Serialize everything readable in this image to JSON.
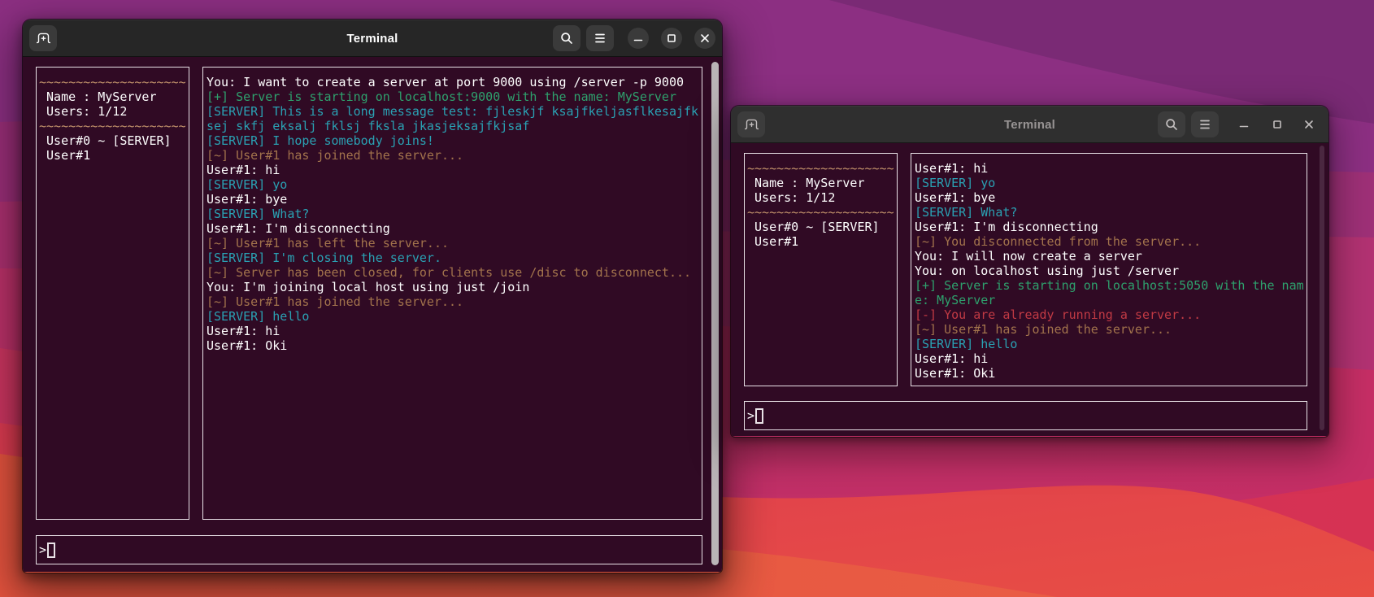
{
  "palette": {
    "term-bg": "#300a24",
    "panel-border": "#e9e2e7",
    "c-fg": "#ffffff",
    "c-green": "#2ea16d",
    "c-cyan": "#2aa1b3",
    "c-brown": "#a2734c",
    "c-tan": "#c4946c",
    "c-red": "#c13a44",
    "hdr-focused": "#262626",
    "hdr-unfocused": "#2f2f2f",
    "btn-focused": "#3a3a3a",
    "btn-unfocused": "#3c3c3c",
    "scroll-focused": "#bab4b7",
    "scroll-unfocused": "#4a2740",
    "w0": "#7a2a75",
    "w1": "#8c2f82",
    "w2a": "#9a2e78",
    "w2b": "#9e3077",
    "w3a": "#ac3070",
    "w3b": "#b23272",
    "w4a": "#bc3169",
    "w4b": "#c52e65",
    "w5a": "#cc3560",
    "w5b": "#d63253",
    "w6a": "#dc3a51",
    "w6b": "#e84e44",
    "w7a": "#e5533e",
    "w7b": "#e95c44"
  },
  "windows": {
    "left": {
      "titlebar": {
        "title": "Terminal"
      },
      "sidebar": {
        "rows": [
          {
            "t": "~~~~~~~~~~~~~~~~~~~~",
            "c": "tan"
          },
          {
            "t": " Name : MyServer",
            "c": "fg"
          },
          {
            "t": " Users: 1/12",
            "c": "fg"
          },
          {
            "t": "~~~~~~~~~~~~~~~~~~~~",
            "c": "tan"
          },
          {
            "t": " User#0 ~ [SERVER]",
            "c": "fg"
          },
          {
            "t": " User#1",
            "c": "fg"
          }
        ]
      },
      "chat": {
        "rows": [
          {
            "t": "You: I want to create a server at port 9000 using /server -p 9000",
            "c": "fg"
          },
          {
            "t": "[+] Server is starting on localhost:9000 with the name: MyServer",
            "c": "green"
          },
          {
            "t": "[SERVER] This is a long message test: fjleskjf ksajfkeljasflkesajfk",
            "c": "cyan"
          },
          {
            "t": "sej skfj eksalj fklsj fksla jkasjeksajfkjsaf",
            "c": "cyan"
          },
          {
            "t": "[SERVER] I hope somebody joins!",
            "c": "cyan"
          },
          {
            "t": "[~] User#1 has joined the server...",
            "c": "brown"
          },
          {
            "t": "User#1: hi",
            "c": "fg"
          },
          {
            "t": "[SERVER] yo",
            "c": "cyan"
          },
          {
            "t": "User#1: bye",
            "c": "fg"
          },
          {
            "t": "[SERVER] What?",
            "c": "cyan"
          },
          {
            "t": "User#1: I'm disconnecting",
            "c": "fg"
          },
          {
            "t": "[~] User#1 has left the server...",
            "c": "brown"
          },
          {
            "t": "[SERVER] I'm closing the server.",
            "c": "cyan"
          },
          {
            "t": "[~] Server has been closed, for clients use /disc to disconnect...",
            "c": "brown"
          },
          {
            "t": "You: I'm joining local host using just /join",
            "c": "fg"
          },
          {
            "t": "[~] User#1 has joined the server...",
            "c": "brown"
          },
          {
            "t": "[SERVER] hello",
            "c": "cyan"
          },
          {
            "t": "User#1: hi",
            "c": "fg"
          },
          {
            "t": "User#1: Oki",
            "c": "fg"
          }
        ]
      },
      "input": {
        "prompt": ">"
      }
    },
    "right": {
      "titlebar": {
        "title": "Terminal"
      },
      "sidebar": {
        "rows": [
          {
            "t": "~~~~~~~~~~~~~~~~~~~~",
            "c": "tan"
          },
          {
            "t": " Name : MyServer",
            "c": "fg"
          },
          {
            "t": " Users: 1/12",
            "c": "fg"
          },
          {
            "t": "~~~~~~~~~~~~~~~~~~~~",
            "c": "tan"
          },
          {
            "t": " User#0 ~ [SERVER]",
            "c": "fg"
          },
          {
            "t": " User#1",
            "c": "fg"
          }
        ]
      },
      "chat": {
        "rows": [
          {
            "t": "User#1: hi",
            "c": "fg"
          },
          {
            "t": "[SERVER] yo",
            "c": "cyan"
          },
          {
            "t": "User#1: bye",
            "c": "fg"
          },
          {
            "t": "[SERVER] What?",
            "c": "cyan"
          },
          {
            "t": "User#1: I'm disconnecting",
            "c": "fg"
          },
          {
            "t": "[~] You disconnected from the server...",
            "c": "brown"
          },
          {
            "t": "You: I will now create a server",
            "c": "fg"
          },
          {
            "t": "You: on localhost using just /server",
            "c": "fg"
          },
          {
            "t": "[+] Server is starting on localhost:5050 with the nam",
            "c": "green"
          },
          {
            "t": "e: MyServer",
            "c": "green"
          },
          {
            "t": "[-] You are already running a server...",
            "c": "red"
          },
          {
            "t": "[~] User#1 has joined the server...",
            "c": "brown"
          },
          {
            "t": "[SERVER] hello",
            "c": "cyan"
          },
          {
            "t": "User#1: hi",
            "c": "fg"
          },
          {
            "t": "User#1: Oki",
            "c": "fg"
          }
        ]
      },
      "input": {
        "prompt": ">"
      }
    }
  }
}
